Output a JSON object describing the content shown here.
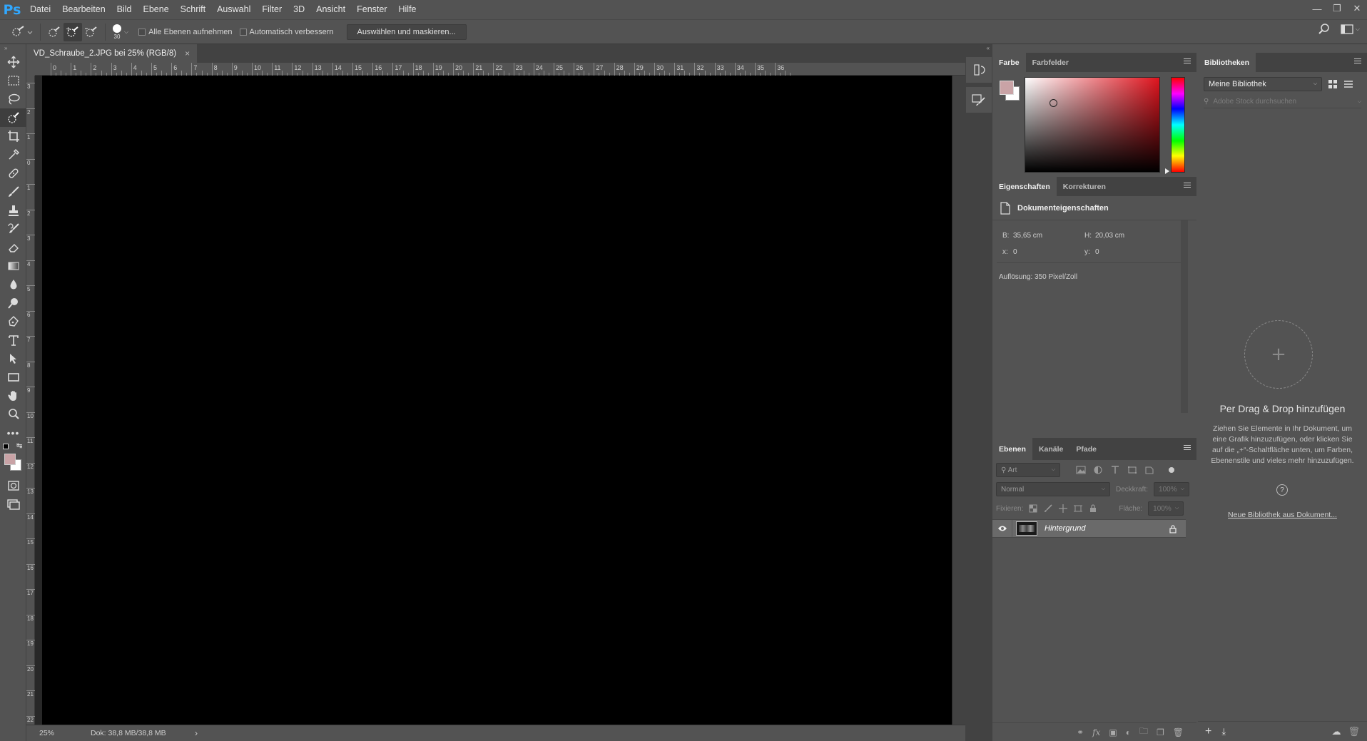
{
  "app": {
    "logo": "Ps",
    "menu": [
      "Datei",
      "Bearbeiten",
      "Bild",
      "Ebene",
      "Schrift",
      "Auswahl",
      "Filter",
      "3D",
      "Ansicht",
      "Fenster",
      "Hilfe"
    ],
    "window_controls": [
      "minimize-icon",
      "restore-icon",
      "close-icon"
    ]
  },
  "options": {
    "brush_size": "30",
    "sample_all_layers": "Alle Ebenen aufnehmen",
    "auto_enhance": "Automatisch verbessern",
    "select_mask_button": "Auswählen und maskieren..."
  },
  "document": {
    "tab_title": "VD_Schraube_2.JPG bei 25% (RGB/8)",
    "tab_close": "×",
    "canvas_color": "#000000"
  },
  "rulers": {
    "top_ticks": [
      "0",
      "1",
      "2",
      "3",
      "4",
      "5",
      "6",
      "7",
      "8",
      "9",
      "10",
      "11",
      "12",
      "13",
      "14",
      "15",
      "16",
      "17",
      "18",
      "19",
      "20",
      "21",
      "22",
      "23",
      "24",
      "25",
      "26",
      "27",
      "28",
      "29",
      "30",
      "31",
      "32",
      "33",
      "34",
      "35",
      "36"
    ],
    "left_ticks": [
      "3",
      "2",
      "1",
      "0",
      "1",
      "2",
      "3",
      "4",
      "5",
      "6",
      "7",
      "8",
      "9",
      "10",
      "11",
      "12",
      "13",
      "14",
      "15",
      "16",
      "17",
      "18",
      "19",
      "20",
      "21",
      "22"
    ]
  },
  "status": {
    "zoom": "25%",
    "doc_info": "Dok: 38,8 MB/38,8 MB",
    "arrow": "›"
  },
  "color_panel": {
    "tabs": [
      "Farbe",
      "Farbfelder"
    ],
    "foreground": "#c9a3a6",
    "background": "#ffffff",
    "hue_color": "#e0141e"
  },
  "properties_panel": {
    "tabs": [
      "Eigenschaften",
      "Korrekturen"
    ],
    "section_title": "Dokumenteigenschaften",
    "b_label": "B:",
    "b_value": "35,65 cm",
    "h_label": "H:",
    "h_value": "20,03 cm",
    "x_label": "x:",
    "x_value": "0",
    "y_label": "y:",
    "y_value": "0",
    "resolution": "Auflösung: 350 Pixel/Zoll"
  },
  "layers_panel": {
    "tabs": [
      "Ebenen",
      "Kanäle",
      "Pfade"
    ],
    "filter_placeholder": "Art",
    "blend_mode": "Normal",
    "opacity_label": "Deckkraft:",
    "opacity_value": "100%",
    "lock_label": "Fixieren:",
    "fill_label": "Fläche:",
    "fill_value": "100%",
    "layers": [
      {
        "name": "Hintergrund",
        "visible": true,
        "locked": true
      }
    ]
  },
  "libraries_panel": {
    "tab": "Bibliotheken",
    "library_select": "Meine Bibliothek",
    "search_placeholder": "Adobe Stock durchsuchen",
    "dropzone_plus": "+",
    "heading": "Per Drag & Drop hinzufügen",
    "description": "Ziehen Sie Elemente in Ihr Dokument, um eine Grafik hinzuzufügen, oder klicken Sie auf die „+“-Schaltfläche unten, um Farben, Ebenenstile und vieles mehr hinzuzufügen.",
    "help": "?",
    "link": "Neue Bibliothek aus Dokument..."
  }
}
